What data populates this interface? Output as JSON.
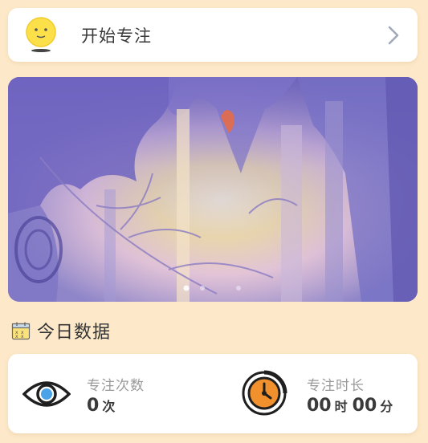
{
  "start_card": {
    "label": "开始专注",
    "avatar_icon": "sun-face-icon",
    "chevron_icon": "chevron-right-icon"
  },
  "banner": {
    "description_icon": "forest-painting-image",
    "active_dot": 0,
    "dot_count": 3
  },
  "today": {
    "title": "今日数据",
    "icon": "calendar-icon"
  },
  "stats": {
    "count": {
      "label": "专注次数",
      "value": "0",
      "unit": "次",
      "icon": "eye-icon"
    },
    "duration": {
      "label": "专注时长",
      "hours": "00",
      "hours_unit": "时",
      "minutes": "00",
      "minutes_unit": "分",
      "icon": "timer-icon"
    }
  },
  "colors": {
    "background": "#fde9c9",
    "card": "#ffffff",
    "accent_orange": "#f0912e",
    "eye_blue": "#4aa3e8"
  }
}
